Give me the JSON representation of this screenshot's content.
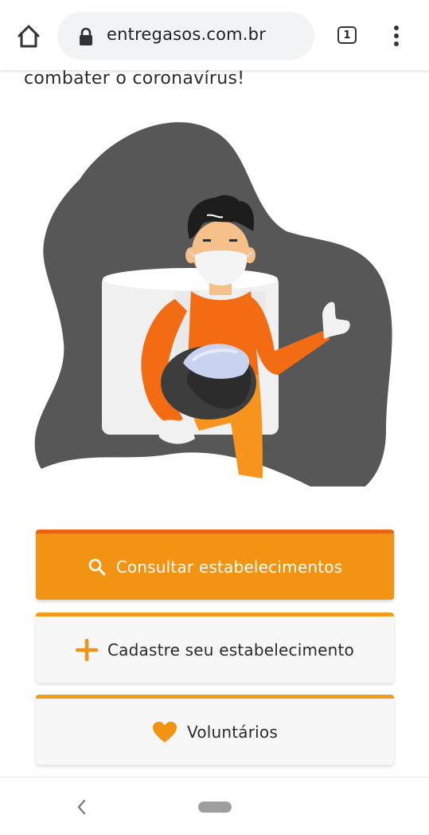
{
  "browser": {
    "url": "entregasos.com.br",
    "tab_count": "1",
    "icons": {
      "home": "home-icon",
      "lock": "lock-icon",
      "tabs": "tab-switcher-icon",
      "menu": "more-vert-icon"
    }
  },
  "page": {
    "headline": "combater o coronavírus!",
    "illustration": "courier-with-mask-illustration",
    "actions": [
      {
        "label": "Consultar estabelecimentos",
        "icon": "search-icon"
      },
      {
        "label": "Cadastre seu estabelecimento",
        "icon": "plus-icon"
      },
      {
        "label": "Voluntários",
        "icon": "heart-icon"
      }
    ]
  },
  "colors": {
    "primary": "#f39314",
    "primary_border": "#e8650e",
    "accent": "#f39c1c",
    "blob": "#575757"
  },
  "navigation": {
    "icons": {
      "back": "back-chevron-icon",
      "home": "home-pill-icon"
    }
  }
}
